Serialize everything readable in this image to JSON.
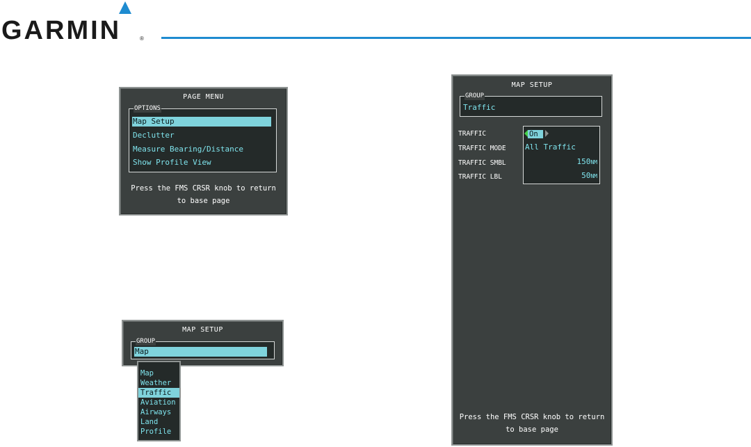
{
  "brand": {
    "name": "GARMIN",
    "reg": "®",
    "accent": "#1e8bd0"
  },
  "page_menu": {
    "title": "PAGE MENU",
    "group_label": "OPTIONS",
    "items": [
      "Map Setup",
      "Declutter",
      "Measure Bearing/Distance",
      "Show Profile View"
    ],
    "selected_index": 0,
    "note_line1": "Press the FMS CRSR knob to return",
    "note_line2": "to base page"
  },
  "map_setup_small": {
    "title": "MAP SETUP",
    "group_label": "GROUP",
    "group_value": "Map",
    "dropdown_options": [
      "Map",
      "Weather",
      "Traffic",
      "Aviation",
      "Airways",
      "Land",
      "Profile"
    ],
    "dropdown_selected": "Traffic"
  },
  "map_setup_large": {
    "title": "MAP SETUP",
    "group_label": "GROUP",
    "group_value": "Traffic",
    "rows": [
      {
        "label": "TRAFFIC",
        "value": "On"
      },
      {
        "label": "TRAFFIC MODE",
        "value": "All Traffic"
      },
      {
        "label": "TRAFFIC SMBL",
        "value": "150",
        "unit": "NM"
      },
      {
        "label": "TRAFFIC LBL",
        "value": "50",
        "unit": "NM"
      }
    ],
    "note_line1": "Press the FMS CRSR knob to return",
    "note_line2": "to base page"
  },
  "colors": {
    "panel_bg": "#3b403f",
    "field_bg": "#242a29",
    "cyan_text": "#7fe3ec",
    "highlight": "#7fd3dc",
    "selector_arrow": "#45d04a"
  }
}
